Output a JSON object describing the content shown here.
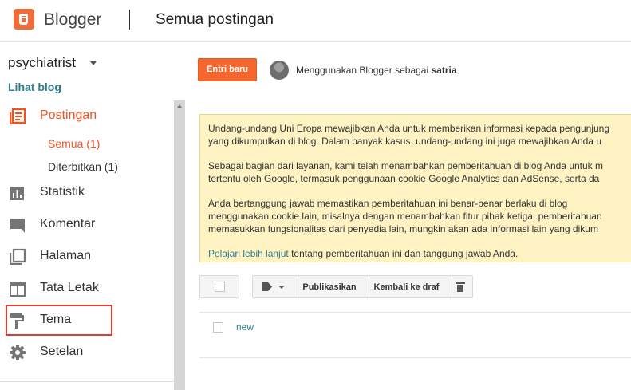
{
  "header": {
    "app_name": "Blogger",
    "page_title": "Semua postingan"
  },
  "sidebar": {
    "blog_name": "psychiatrist",
    "view_blog": "Lihat blog",
    "items": [
      {
        "label": "Postingan",
        "icon": "posts-icon"
      },
      {
        "label": "Statistik",
        "icon": "stats-icon"
      },
      {
        "label": "Komentar",
        "icon": "comment-icon"
      },
      {
        "label": "Halaman",
        "icon": "pages-icon"
      },
      {
        "label": "Tata Letak",
        "icon": "layout-icon"
      },
      {
        "label": "Tema",
        "icon": "paint-roller-icon"
      },
      {
        "label": "Setelan",
        "icon": "gear-icon"
      }
    ],
    "sub_items": [
      {
        "label": "Semua (1)"
      },
      {
        "label": "Diterbitkan (1)"
      }
    ]
  },
  "main": {
    "new_post": "Entri baru",
    "using_prefix": "Menggunakan Blogger sebagai",
    "user": "satria",
    "notice": {
      "line1": "Undang-undang Uni Eropa mewajibkan Anda untuk memberikan informasi kepada pengunjung",
      "line2": "yang dikumpulkan di blog. Dalam banyak kasus, undang-undang ini juga mewajibkan Anda u",
      "line3": "Sebagai bagian dari layanan, kami telah menambahkan pemberitahuan di blog Anda untuk m",
      "line4": "tertentu oleh Google, termasuk penggunaan cookie Google Analytics dan AdSense, serta da",
      "line5": "Anda bertanggung jawab memastikan pemberitahuan ini benar-benar berlaku di blog",
      "line6": "menggunakan cookie lain, misalnya dengan menambahkan fitur pihak ketiga, pemberitahuan",
      "line7": "memasukkan fungsionalitas dari penyedia lain, mungkin akan ada informasi lain yang dikum",
      "link": "Pelajari lebih lanjut",
      "tail": " tentang pemberitahuan ini dan tanggung jawab Anda."
    },
    "toolbar": {
      "publish": "Publikasikan",
      "revert": "Kembali ke draf"
    },
    "posts": [
      {
        "title": "new"
      }
    ]
  }
}
